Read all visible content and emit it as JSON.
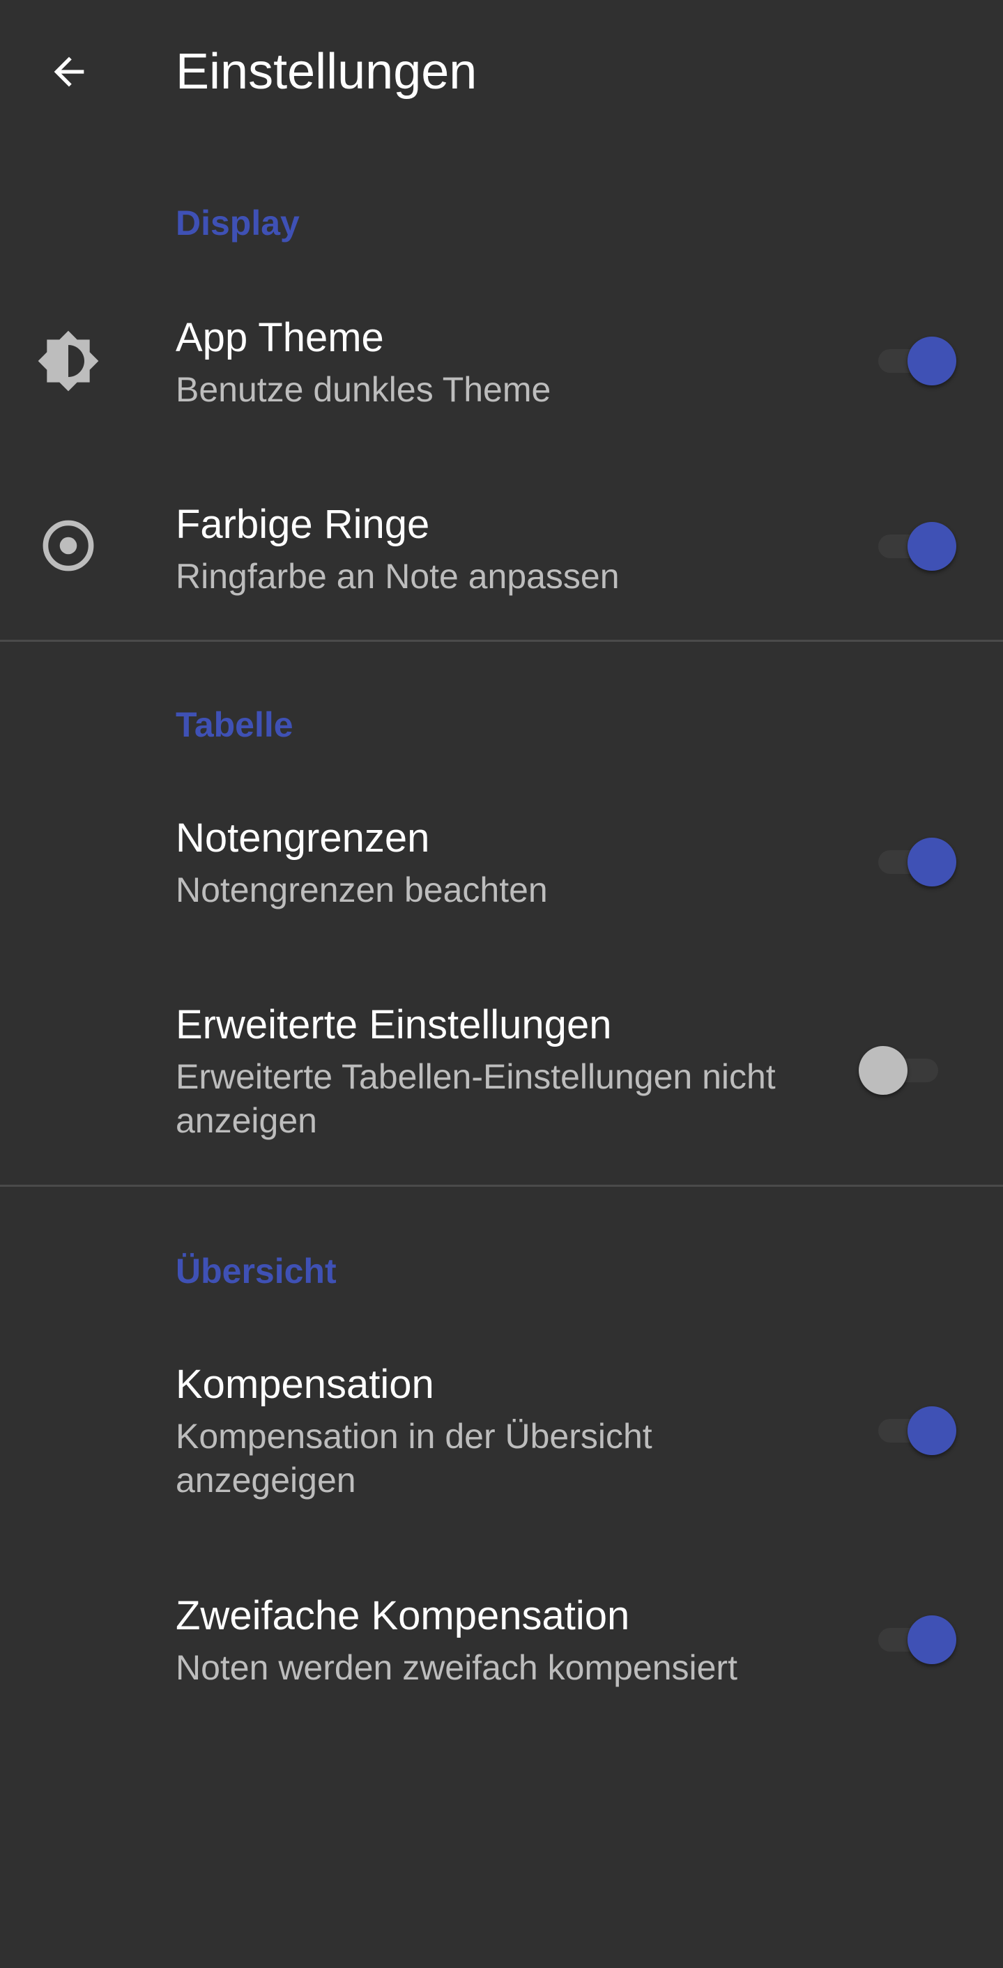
{
  "header": {
    "back_icon": "arrow-left-icon",
    "title": "Einstellungen"
  },
  "colors": {
    "background": "#303030",
    "accent": "#3f51b5",
    "switch_off_thumb": "#bdbdbd"
  },
  "sections": [
    {
      "header": "Display",
      "items": [
        {
          "icon": "brightness-icon",
          "title": "App Theme",
          "summary": "Benutze dunkles Theme",
          "checked": true
        },
        {
          "icon": "radio-ring-icon",
          "title": "Farbige Ringe",
          "summary": "Ringfarbe an Note anpassen",
          "checked": true
        }
      ]
    },
    {
      "header": "Tabelle",
      "items": [
        {
          "title": "Notengrenzen",
          "summary": "Notengrenzen beachten",
          "checked": true
        },
        {
          "title": "Erweiterte Einstellungen",
          "summary": "Erweiterte Tabellen-Einstellungen nicht anzeigen",
          "checked": false
        }
      ]
    },
    {
      "header": "Übersicht",
      "items": [
        {
          "title": "Kompensation",
          "summary": "Kompensation in der Übersicht anzegeigen",
          "checked": true
        },
        {
          "title": "Zweifache Kompensation",
          "summary": "Noten werden zweifach kompensiert",
          "checked": true
        }
      ]
    }
  ]
}
